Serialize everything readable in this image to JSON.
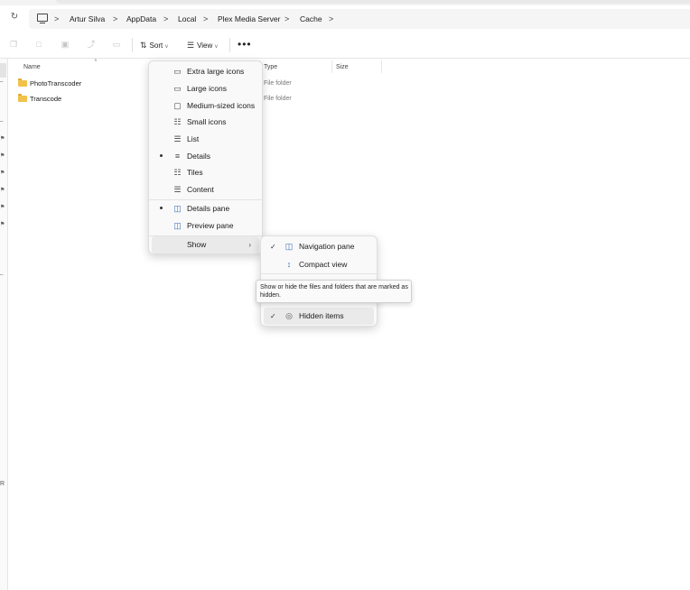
{
  "address": {
    "crumbs": [
      "Artur Silva",
      "AppData",
      "Local",
      "Plex Media Server",
      "Cache"
    ],
    "separator": ">"
  },
  "toolbar": {
    "sort_label": "Sort",
    "view_label": "View",
    "more_label": "•••"
  },
  "columns": {
    "name": "Name",
    "type": "Type",
    "size": "Size"
  },
  "files": [
    {
      "name": "PhotoTranscoder",
      "type": "File folder"
    },
    {
      "name": "Transcode",
      "type": "File folder"
    }
  ],
  "view_menu": {
    "items": [
      {
        "label": "Extra large icons",
        "icon": "monitor-icon",
        "selected": false
      },
      {
        "label": "Large icons",
        "icon": "monitor-icon",
        "selected": false
      },
      {
        "label": "Medium-sized icons",
        "icon": "image-icon",
        "selected": false
      },
      {
        "label": "Small icons",
        "icon": "grid-icon",
        "selected": false
      },
      {
        "label": "List",
        "icon": "list-icon",
        "selected": false
      },
      {
        "label": "Details",
        "icon": "details-icon",
        "selected": true
      },
      {
        "label": "Tiles",
        "icon": "tiles-icon",
        "selected": false
      },
      {
        "label": "Content",
        "icon": "content-icon",
        "selected": false
      }
    ],
    "panes": [
      {
        "label": "Details pane",
        "icon": "details-pane-icon",
        "selected": true
      },
      {
        "label": "Preview pane",
        "icon": "preview-pane-icon",
        "selected": false
      }
    ],
    "show_label": "Show"
  },
  "show_submenu": {
    "items": [
      {
        "label": "Navigation pane",
        "icon": "navigation-pane-icon",
        "checked": true
      },
      {
        "label": "Compact view",
        "icon": "compact-view-icon",
        "checked": false
      },
      {
        "label": "Hidden items",
        "icon": "eye-icon",
        "checked": true
      }
    ]
  },
  "tooltip": {
    "text": "Show or hide the files and folders that are marked as hidden."
  },
  "left_edge_letter": "R"
}
